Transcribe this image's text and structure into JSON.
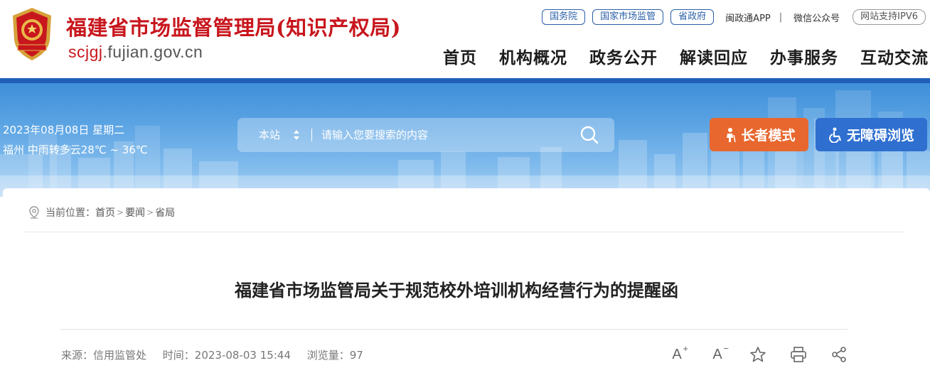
{
  "header": {
    "title": "福建省市场监督管理局(知识产权局)",
    "domain_prefix": "scjgj",
    "domain_suffix": ".fujian.gov.cn",
    "emblem_icon": "government-emblem-icon"
  },
  "toplinks": {
    "pills": [
      "国务院",
      "国家市场监管",
      "省政府"
    ],
    "app": "闽政通APP",
    "separator": "|",
    "wechat": "微信公众号",
    "ipv6": "网站支持IPV6"
  },
  "nav": [
    "首页",
    "机构概况",
    "政务公开",
    "解读回应",
    "办事服务",
    "互动交流"
  ],
  "banner": {
    "date": "2023年08月08日 星期二",
    "weather": "福州 中雨转多云28℃ ~ 36℃",
    "search_scope": "本站",
    "search_placeholder": "请输入您要搜索的内容",
    "elder_mode": "长者模式",
    "accessibility": "无障碍浏览"
  },
  "breadcrumb": {
    "label": "当前位置：",
    "items": [
      "首页",
      "要闻",
      "省局"
    ],
    "separator": ">"
  },
  "article": {
    "title": "福建省市场监管局关于规范校外培训机构经营行为的提醒函",
    "source": "来源：信用监管处",
    "time": "时间：2023-08-03 15:44",
    "views": "浏览量：97"
  },
  "tools": {
    "font_increase": "A",
    "font_increase_sup": "+",
    "font_decrease": "A",
    "font_decrease_sup": "−"
  },
  "colors": {
    "brand_red": "#c8161d",
    "brand_blue": "#1f5fb8",
    "elder_orange": "#e8672e",
    "access_blue": "#2e6fd0"
  }
}
